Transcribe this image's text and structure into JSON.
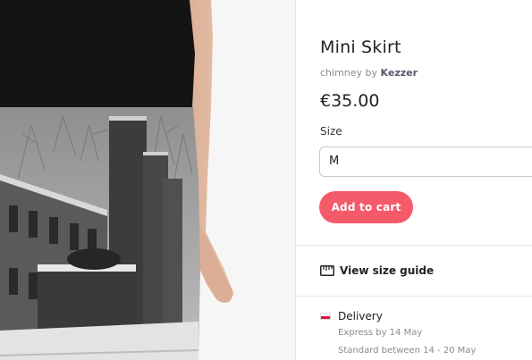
{
  "product": {
    "title": "Mini Skirt",
    "byline_prefix": "chimney by ",
    "artist": "Kezzer",
    "price": "€35.00",
    "image_alt": "Mini skirt printed with a snowy black-and-white photo of brick chimneys and buildings"
  },
  "size": {
    "label": "Size",
    "selected": "M"
  },
  "actions": {
    "add_to_cart": "Add to cart",
    "size_guide": "View size guide"
  },
  "delivery": {
    "heading": "Delivery",
    "express": "Express by 14 May",
    "standard": "Standard between 14 - 20 May"
  },
  "colors": {
    "accent": "#f55a6b",
    "text": "#222222",
    "muted": "#8a8a8a"
  },
  "icons": {
    "size_guide": "ruler-icon",
    "delivery": "poland-flag-icon"
  }
}
